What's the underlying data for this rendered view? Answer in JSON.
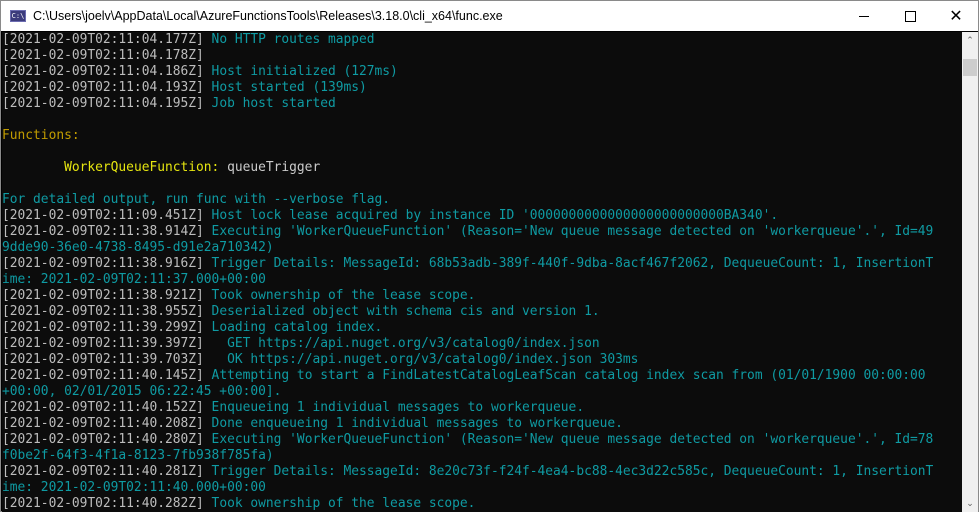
{
  "window": {
    "title": "C:\\Users\\joelv\\AppData\\Local\\AzureFunctionsTools\\Releases\\3.18.0\\cli_x64\\func.exe",
    "icon": "console-app-icon",
    "icon_text": "C:\\",
    "controls": {
      "minimize": "minimize-icon",
      "maximize": "maximize-icon",
      "close": "close-icon",
      "close_glyph": "✕"
    }
  },
  "scrollbar": {
    "up_glyph": "⌃",
    "down_glyph": "⌄",
    "position": 0.02
  },
  "console": {
    "lines": [
      {
        "ts": "[2021-02-09T02:11:04.177Z]",
        "text": " No HTTP routes mapped",
        "color": "cyan"
      },
      {
        "ts": "[2021-02-09T02:11:04.178Z]",
        "text": "",
        "color": "cyan"
      },
      {
        "ts": "[2021-02-09T02:11:04.186Z]",
        "text": " Host initialized (127ms)",
        "color": "cyan"
      },
      {
        "ts": "[2021-02-09T02:11:04.193Z]",
        "text": " Host started (139ms)",
        "color": "cyan"
      },
      {
        "ts": "[2021-02-09T02:11:04.195Z]",
        "text": " Job host started",
        "color": "cyan"
      },
      {
        "ts": "",
        "text": "",
        "color": "cyan"
      },
      {
        "ts": "",
        "text": "Functions:",
        "color": "yellow"
      },
      {
        "ts": "",
        "text": "",
        "color": "cyan"
      },
      {
        "ts": "",
        "text": "",
        "color": "function",
        "fn_indent": "        ",
        "fn_name": "WorkerQueueFunction:",
        "fn_trigger": " queueTrigger"
      },
      {
        "ts": "",
        "text": "",
        "color": "cyan"
      },
      {
        "ts": "",
        "text": "For detailed output, run func with --verbose flag.",
        "color": "cyan"
      },
      {
        "ts": "[2021-02-09T02:11:09.451Z]",
        "text": " Host lock lease acquired by instance ID '0000000000000000000000000BA340'.",
        "color": "cyan"
      },
      {
        "ts": "[2021-02-09T02:11:38.914Z]",
        "text": " Executing 'WorkerQueueFunction' (Reason='New queue message detected on 'workerqueue'.', Id=49",
        "color": "cyan"
      },
      {
        "ts": "",
        "text": "9dde90-36e0-4738-8495-d91e2a710342)",
        "color": "cyan"
      },
      {
        "ts": "[2021-02-09T02:11:38.916Z]",
        "text": " Trigger Details: MessageId: 68b53adb-389f-440f-9dba-8acf467f2062, DequeueCount: 1, InsertionT",
        "color": "cyan"
      },
      {
        "ts": "",
        "text": "ime: 2021-02-09T02:11:37.000+00:00",
        "color": "cyan"
      },
      {
        "ts": "[2021-02-09T02:11:38.921Z]",
        "text": " Took ownership of the lease scope.",
        "color": "cyan"
      },
      {
        "ts": "[2021-02-09T02:11:38.955Z]",
        "text": " Deserialized object with schema cis and version 1.",
        "color": "cyan"
      },
      {
        "ts": "[2021-02-09T02:11:39.299Z]",
        "text": " Loading catalog index.",
        "color": "cyan"
      },
      {
        "ts": "[2021-02-09T02:11:39.397Z]",
        "text": "   GET https://api.nuget.org/v3/catalog0/index.json",
        "color": "cyan"
      },
      {
        "ts": "[2021-02-09T02:11:39.703Z]",
        "text": "   OK https://api.nuget.org/v3/catalog0/index.json 303ms",
        "color": "cyan"
      },
      {
        "ts": "[2021-02-09T02:11:40.145Z]",
        "text": " Attempting to start a FindLatestCatalogLeafScan catalog index scan from (01/01/1900 00:00:00",
        "color": "cyan"
      },
      {
        "ts": "",
        "text": "+00:00, 02/01/2015 06:22:45 +00:00].",
        "color": "cyan"
      },
      {
        "ts": "[2021-02-09T02:11:40.152Z]",
        "text": " Enqueueing 1 individual messages to workerqueue.",
        "color": "cyan"
      },
      {
        "ts": "[2021-02-09T02:11:40.208Z]",
        "text": " Done enqueueing 1 individual messages to workerqueue.",
        "color": "cyan"
      },
      {
        "ts": "[2021-02-09T02:11:40.280Z]",
        "text": " Executing 'WorkerQueueFunction' (Reason='New queue message detected on 'workerqueue'.', Id=78",
        "color": "cyan"
      },
      {
        "ts": "",
        "text": "f0be2f-64f3-4f1a-8123-7fb938f785fa)",
        "color": "cyan"
      },
      {
        "ts": "[2021-02-09T02:11:40.281Z]",
        "text": " Trigger Details: MessageId: 8e20c73f-f24f-4ea4-bc88-4ec3d22c585c, DequeueCount: 1, InsertionT",
        "color": "cyan"
      },
      {
        "ts": "",
        "text": "ime: 2021-02-09T02:11:40.000+00:00",
        "color": "cyan"
      },
      {
        "ts": "[2021-02-09T02:11:40.282Z]",
        "text": " Took ownership of the lease scope.",
        "color": "cyan"
      }
    ]
  }
}
